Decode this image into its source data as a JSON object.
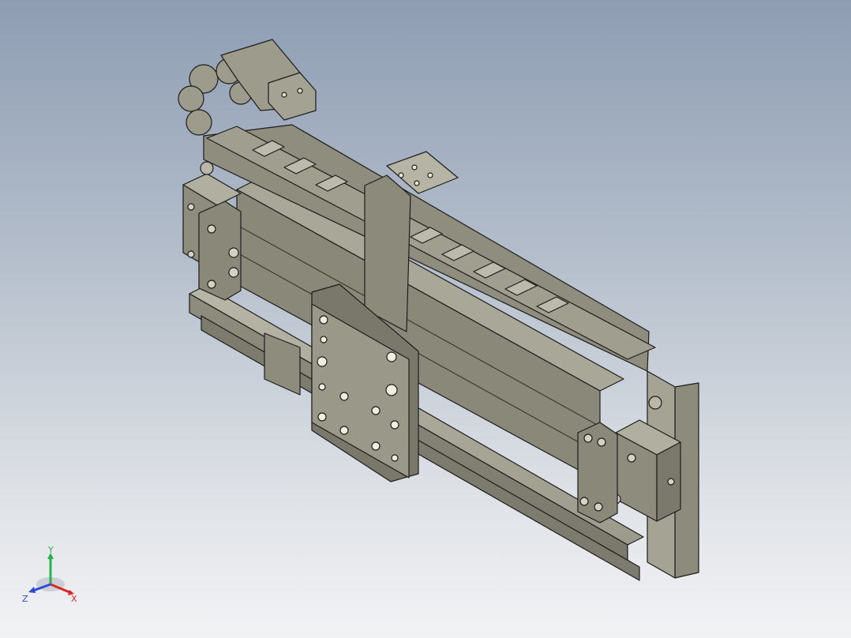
{
  "viewport": {
    "background_top": "#8e9db3",
    "background_bottom": "#f2f3f5"
  },
  "model": {
    "description_icon": "linear-actuator-assembly",
    "body_color": "#8c8a7b",
    "edge_color": "#1c1c1c"
  },
  "triad": {
    "x_label": "X",
    "y_label": "Y",
    "z_label": "Z",
    "x_color": "#d8262a",
    "y_color": "#2bb24c",
    "z_color": "#2c4bd3"
  }
}
